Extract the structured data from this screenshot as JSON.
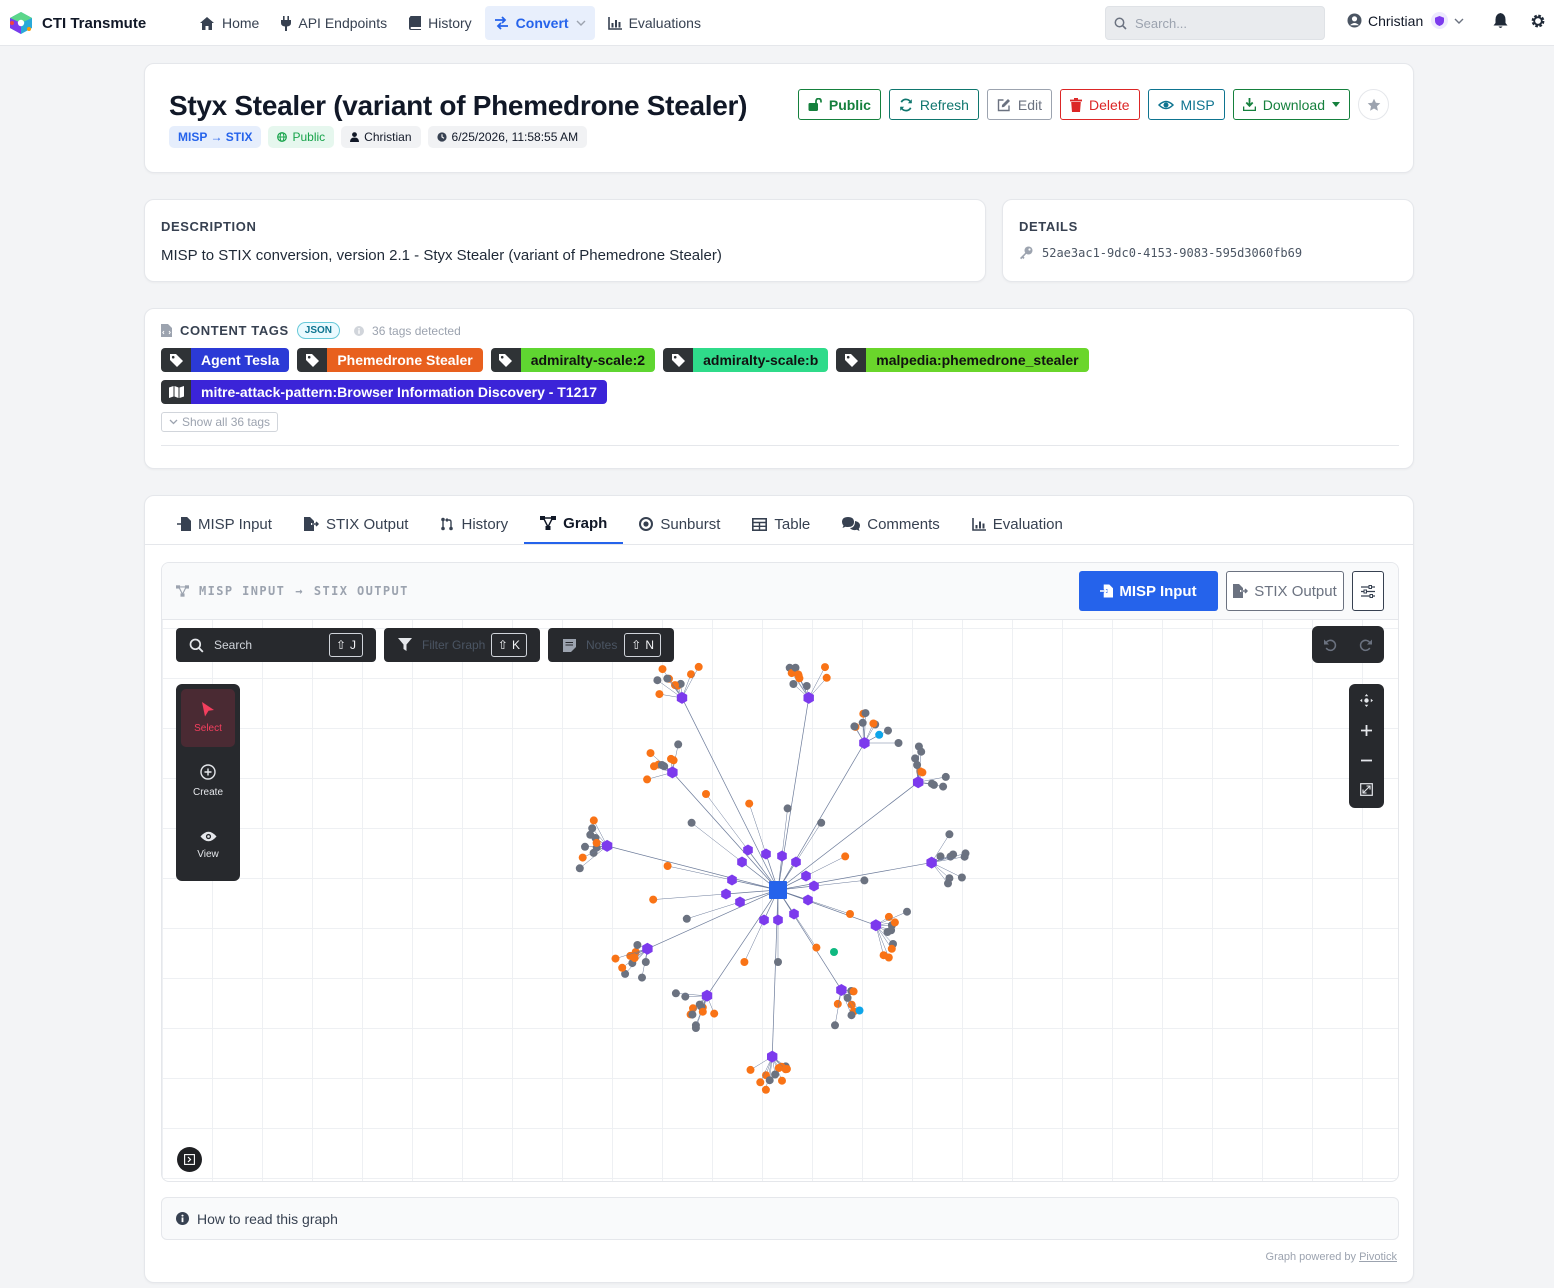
{
  "nav": {
    "brand": "CTI Transmute",
    "items": [
      {
        "label": "Home",
        "icon": "home-icon"
      },
      {
        "label": "API Endpoints",
        "icon": "plug-icon"
      },
      {
        "label": "History",
        "icon": "book-icon"
      },
      {
        "label": "Convert",
        "icon": "exchange-icon",
        "active": true
      },
      {
        "label": "Evaluations",
        "icon": "bar-chart-icon"
      }
    ],
    "search_placeholder": "Search...",
    "user": "Christian"
  },
  "header": {
    "title": "Styx Stealer (variant of Phemedrone Stealer)",
    "conversion": "MISP → STIX",
    "visibility": "Public",
    "author": "Christian",
    "timestamp": "6/25/2026, 11:58:55 AM",
    "actions": {
      "public": "Public",
      "refresh": "Refresh",
      "edit": "Edit",
      "delete": "Delete",
      "misp": "MISP",
      "download": "Download"
    }
  },
  "description": {
    "label": "DESCRIPTION",
    "text": "MISP to STIX conversion, version 2.1 - Styx Stealer (variant of Phemedrone Stealer)"
  },
  "details": {
    "label": "DETAILS",
    "uuid": "52ae3ac1-9dc0-4153-9083-595d3060fb69"
  },
  "content_tags": {
    "label": "CONTENT TAGS",
    "format": "JSON",
    "count_text": "36 tags detected",
    "tags": [
      {
        "text": "Agent Tesla",
        "bg": "#2b3ad6",
        "fg": "#ffffff"
      },
      {
        "text": "Phemedrone Stealer",
        "bg": "#e8601e",
        "fg": "#ffffff"
      },
      {
        "text": "admiralty-scale:2",
        "bg": "#5fd631",
        "fg": "#111111"
      },
      {
        "text": "admiralty-scale:b",
        "bg": "#2fdb8a",
        "fg": "#111111"
      },
      {
        "text": "malpedia:phemedrone_stealer",
        "bg": "#6ad62b",
        "fg": "#111111"
      }
    ],
    "attack_tag": {
      "text": "mitre-attack-pattern:Browser Information Discovery - T1217",
      "bg": "#3b24d8",
      "fg": "#ffffff"
    },
    "show_all": "Show all 36 tags"
  },
  "tabs": [
    {
      "label": "MISP Input",
      "icon": "file-import-icon"
    },
    {
      "label": "STIX Output",
      "icon": "file-export-icon"
    },
    {
      "label": "History",
      "icon": "history-icon"
    },
    {
      "label": "Graph",
      "icon": "graph-icon",
      "active": true
    },
    {
      "label": "Sunburst",
      "icon": "sunburst-icon"
    },
    {
      "label": "Table",
      "icon": "table-icon"
    },
    {
      "label": "Comments",
      "icon": "comments-icon"
    },
    {
      "label": "Evaluation",
      "icon": "evaluation-icon"
    }
  ],
  "graph": {
    "breadcrumb_from": "MISP INPUT",
    "breadcrumb_arrow": "→",
    "breadcrumb_to": "STIX OUTPUT",
    "btn_input": "MISP Input",
    "btn_output": "STIX Output",
    "search_placeholder": "Search",
    "search_key": "J",
    "filter_placeholder": "Filter Graph",
    "filter_key": "K",
    "notes_placeholder": "Notes",
    "notes_key": "N",
    "tools": [
      {
        "label": "Select",
        "icon": "cursor-icon",
        "active": true
      },
      {
        "label": "Create",
        "icon": "plus-circle-icon"
      },
      {
        "label": "View",
        "icon": "eye-icon"
      }
    ],
    "colors": {
      "center": "#2563eb",
      "object": "#7c3aed",
      "attribute": "#f97316",
      "leaf": "#6b7280",
      "cyan": "#0ea5e9",
      "green": "#10b981"
    },
    "how_to": "How to read this graph",
    "powered_by": "Graph powered by",
    "powered_link": "Pivotick"
  }
}
